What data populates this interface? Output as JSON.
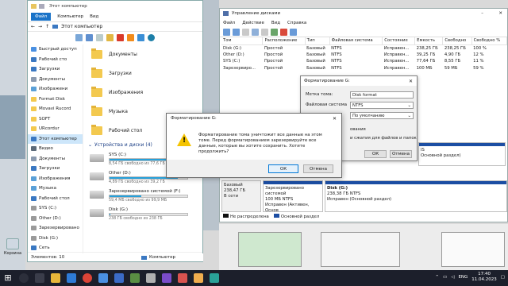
{
  "explorer": {
    "title": "Этот компьютер",
    "tabs": [
      "Файл",
      "Компьютер",
      "Вид"
    ],
    "address": "Этот компьютер",
    "nav_items": [
      {
        "label": "Быстрый доступ",
        "icon": "star-icon"
      },
      {
        "label": "Рабочий сто",
        "icon": "desktop-icon"
      },
      {
        "label": "Загрузки",
        "icon": "download-icon"
      },
      {
        "label": "Документы",
        "icon": "document-icon"
      },
      {
        "label": "Изображени",
        "icon": "picture-icon"
      },
      {
        "label": "Format Disk",
        "icon": "folder-icon"
      },
      {
        "label": "Movavi Rucord",
        "icon": "folder-icon"
      },
      {
        "label": "SOFT",
        "icon": "folder-icon"
      },
      {
        "label": "URcordur",
        "icon": "folder-icon"
      },
      {
        "label": "Этот компьютер",
        "icon": "computer-icon"
      },
      {
        "label": "Видео",
        "icon": "video-icon"
      },
      {
        "label": "Документы",
        "icon": "document-icon"
      },
      {
        "label": "Загрузки",
        "icon": "download-icon"
      },
      {
        "label": "Изображения",
        "icon": "picture-icon"
      },
      {
        "label": "Музыка",
        "icon": "music-icon"
      },
      {
        "label": "Рабочий стол",
        "icon": "desktop-icon"
      },
      {
        "label": "SYS (C:)",
        "icon": "drive-icon"
      },
      {
        "label": "Other (D:)",
        "icon": "drive-icon"
      },
      {
        "label": "Зарезервировано",
        "icon": "drive-icon"
      },
      {
        "label": "Disk (G:)",
        "icon": "drive-icon"
      },
      {
        "label": "Сеть",
        "icon": "network-icon"
      }
    ],
    "folders": [
      "Документы",
      "Загрузки",
      "Изображения",
      "Музыка",
      "Рабочий стол"
    ],
    "section_title": "Устройства и диски (4)",
    "drives": [
      {
        "name": "SYS (C:)",
        "sub": "8,54 ГБ свободно из 77,6 ГБ",
        "used": 0.89
      },
      {
        "name": "Other (D:)",
        "sub": "4,89 ГБ свободно из 39,2 ГБ",
        "used": 0.88
      },
      {
        "name": "Зарезервировано системой (F:)",
        "sub": "59,4 МБ свободно из 99,9 МБ",
        "used": 0.41
      },
      {
        "name": "Disk (G:)",
        "sub": "238 ГБ свободно из 238 ГБ",
        "used": 0.01
      }
    ],
    "status": "Элементов: 10",
    "status2": "Компьютер"
  },
  "desktop": {
    "trash_label": "Корзина",
    "status_left": "Элементов: 10"
  },
  "disk_mgmt": {
    "title": "Управление дисками",
    "menu": [
      "Файл",
      "Действие",
      "Вид",
      "Справка"
    ],
    "columns": [
      "Том",
      "Расположение",
      "Тип",
      "Файловая система",
      "Состояние",
      "Емкость",
      "Свободно",
      "Свободно %"
    ],
    "rows": [
      [
        "Disk (G:)",
        "Простой",
        "Базовый",
        "NTFS",
        "Исправен...",
        "238,25 ГБ",
        "238,25 ГБ",
        "100 %"
      ],
      [
        "Other (D:)",
        "Простой",
        "Базовый",
        "NTFS",
        "Исправен...",
        "39,25 ГБ",
        "4,90 ГБ",
        "12 %"
      ],
      [
        "SYS (C:)",
        "Простой",
        "Базовый",
        "NTFS",
        "Исправен...",
        "77,64 ГБ",
        "8,55 ГБ",
        "11 %"
      ],
      [
        "Зарезервиро...",
        "Простой",
        "Базовый",
        "NTFS",
        "Исправен...",
        "100 МБ",
        "59 МБ",
        "59 %"
      ]
    ],
    "disk1": {
      "head": [
        "Базовый",
        "238,47 ГБ",
        "В сети"
      ],
      "part1": [
        "Зарезервировано системой",
        "100 МБ NTFS",
        "Исправен (Активен, Основ"
      ],
      "part2": [
        "Disk (G:)",
        "238,38 ГБ NTFS",
        "Исправен (Основной раздел)"
      ]
    },
    "upper_part_right": [
      "IS",
      "Основной раздел)"
    ],
    "legend": [
      "Не распределена",
      "Основной раздел"
    ]
  },
  "format_dialog": {
    "title": "Форматирование G:",
    "label_volume": "Метка тома:",
    "value_volume": "Disk format",
    "label_fs": "Файловая система",
    "value_fs": "NTFS",
    "value_cluster": "По умолчанию",
    "label_format": "ования",
    "label_quick": "и сжатия для файлов и папок",
    "ok": "ОК",
    "cancel": "Отмена"
  },
  "confirm_dialog": {
    "title": "Форматирование G:",
    "message": "Форматирование тома уничтожит все данные на этом томе. Перед форматированием зарезервируйте все данные, которые вы хотите сохранить. Хотите продолжить?",
    "ok": "ОК",
    "cancel": "Отмена"
  },
  "taskbar": {
    "lang": "ENG",
    "time": "17:40",
    "date": "11.04.2023"
  }
}
